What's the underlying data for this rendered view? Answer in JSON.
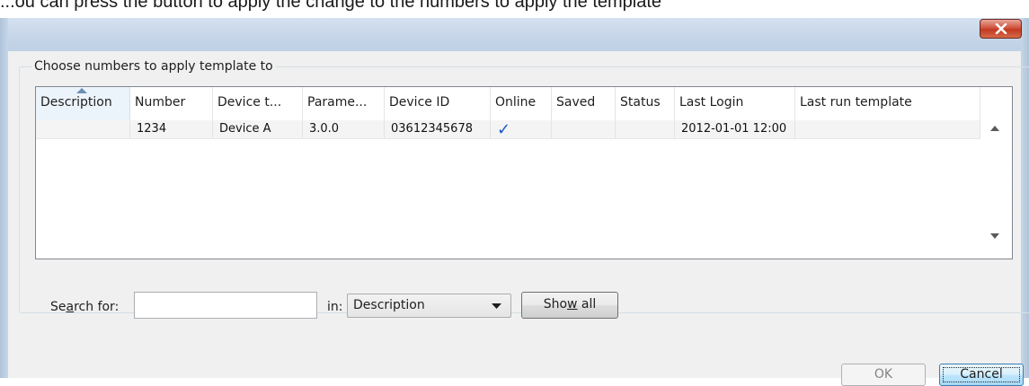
{
  "caption": {
    "text": "...ou can press the button to apply the change to the numbers to apply the template"
  },
  "window": {
    "close_icon": "close-icon",
    "accent_close": "#c23a22",
    "group_title": "Choose numbers to apply template to"
  },
  "table": {
    "columns": [
      "Description",
      "Number",
      "Device t...",
      "Parame...",
      "Device ID",
      "Online",
      "Saved",
      "Status",
      "Last Login",
      "Last run template"
    ],
    "sorted_column": "Description",
    "rows": [
      {
        "description": "",
        "number": "1234",
        "device_type": "Device A",
        "parameter": "3.0.0",
        "device_id": "03612345678",
        "online": "✓",
        "saved": "",
        "status": "",
        "last_login": "2012-01-01 12:00",
        "last_run_template": ""
      }
    ]
  },
  "search": {
    "label_pre": "Se",
    "label_key": "a",
    "label_post": "rch for:",
    "value": "",
    "in_label": "in:",
    "field_selected": "Description",
    "show_all_pre": "Sho",
    "show_all_key": "w",
    "show_all_post": " all"
  },
  "buttons": {
    "ok": "OK",
    "cancel": "Cancel"
  }
}
